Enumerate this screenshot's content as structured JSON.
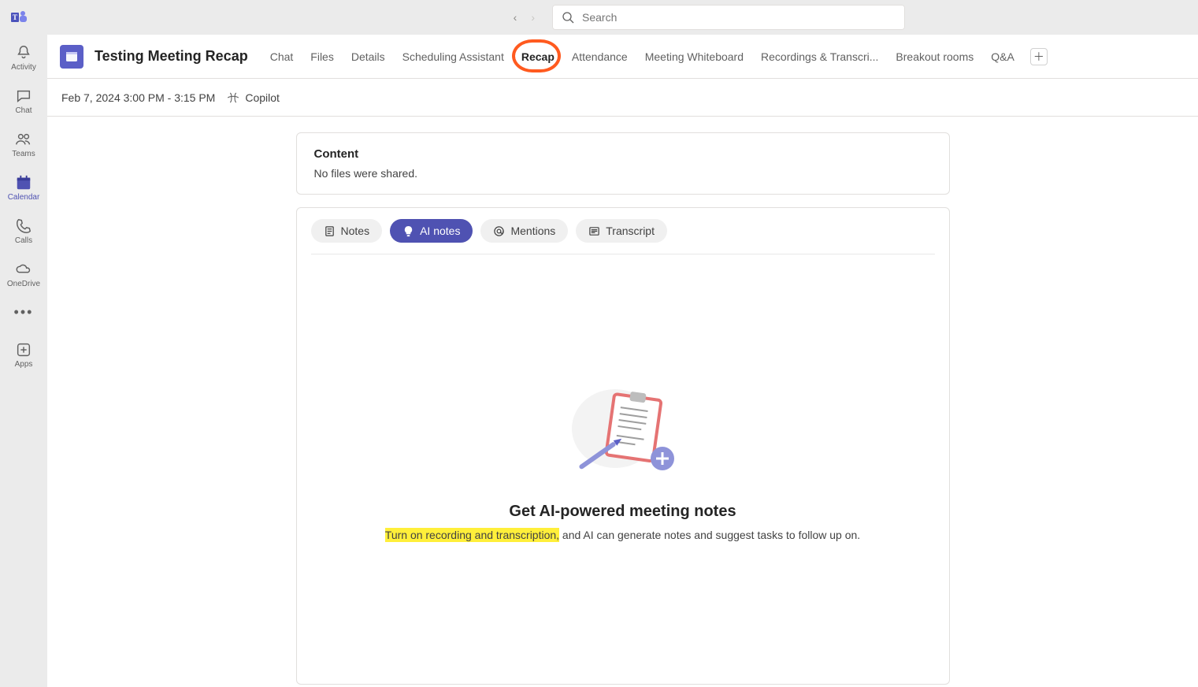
{
  "search": {
    "placeholder": "Search"
  },
  "sidebar": {
    "items": [
      {
        "label": "Activity"
      },
      {
        "label": "Chat"
      },
      {
        "label": "Teams"
      },
      {
        "label": "Calendar"
      },
      {
        "label": "Calls"
      },
      {
        "label": "OneDrive"
      },
      {
        "label": "Apps"
      }
    ]
  },
  "header": {
    "meeting_title": "Testing Meeting Recap",
    "tabs": [
      "Chat",
      "Files",
      "Details",
      "Scheduling Assistant",
      "Recap",
      "Attendance",
      "Meeting Whiteboard",
      "Recordings & Transcri...",
      "Breakout rooms",
      "Q&A"
    ]
  },
  "subbar": {
    "datetime": "Feb 7, 2024 3:00 PM - 3:15 PM",
    "copilot_label": "Copilot"
  },
  "content_card": {
    "title": "Content",
    "message": "No files were shared."
  },
  "pills": {
    "notes": "Notes",
    "ai_notes": "AI notes",
    "mentions": "Mentions",
    "transcript": "Transcript"
  },
  "empty": {
    "title": "Get AI-powered meeting notes",
    "highlight": "Turn on recording and transcription,",
    "rest": " and AI can generate notes and suggest tasks to follow up on."
  }
}
